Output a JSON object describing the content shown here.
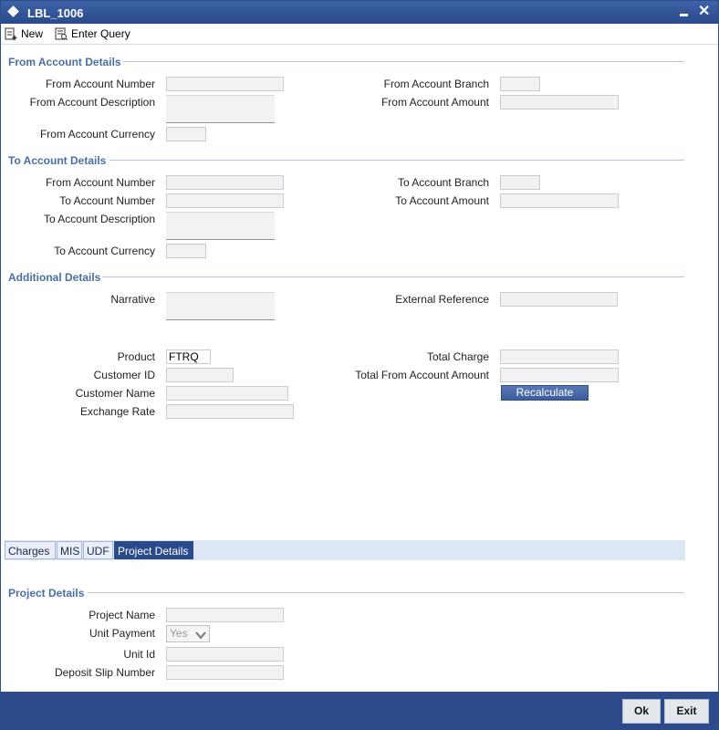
{
  "window": {
    "title": "LBL_1006"
  },
  "toolbar": {
    "new_label": "New",
    "enter_query_label": "Enter Query"
  },
  "from_section": {
    "title": "From Account Details",
    "account_number_label": "From Account Number",
    "account_description_label": "From Account Description",
    "account_currency_label": "From Account Currency",
    "account_branch_label": "From Account Branch",
    "account_amount_label": "From Account Amount"
  },
  "to_section": {
    "title": "To Account Details",
    "from_account_number_label": "From Account Number",
    "to_account_number_label": "To Account Number",
    "to_account_description_label": "To Account Description",
    "to_account_currency_label": "To Account Currency",
    "to_account_branch_label": "To Account Branch",
    "to_account_amount_label": "To Account Amount"
  },
  "additional_section": {
    "title": "Additional Details",
    "narrative_label": "Narrative",
    "external_reference_label": "External Reference",
    "product_label": "Product",
    "product_value": "FTRQ",
    "customer_id_label": "Customer ID",
    "customer_name_label": "Customer Name",
    "exchange_rate_label": "Exchange Rate",
    "total_charge_label": "Total Charge",
    "total_from_account_amount_label": "Total From Account Amount",
    "recalculate_label": "Recalculate"
  },
  "tabs": [
    {
      "label": "Charges"
    },
    {
      "label": "MIS"
    },
    {
      "label": "UDF"
    },
    {
      "label": "Project Details",
      "active": true
    }
  ],
  "project_section": {
    "title": "Project Details",
    "project_name_label": "Project Name",
    "unit_payment_label": "Unit Payment",
    "unit_payment_value": "Yes",
    "unit_id_label": "Unit Id",
    "deposit_slip_number_label": "Deposit Slip Number"
  },
  "footer": {
    "ok_label": "Ok",
    "exit_label": "Exit"
  },
  "colors": {
    "titlebar": "#2a4a8b",
    "section_title": "#4a6ea6",
    "footer": "#2d4b8a"
  }
}
